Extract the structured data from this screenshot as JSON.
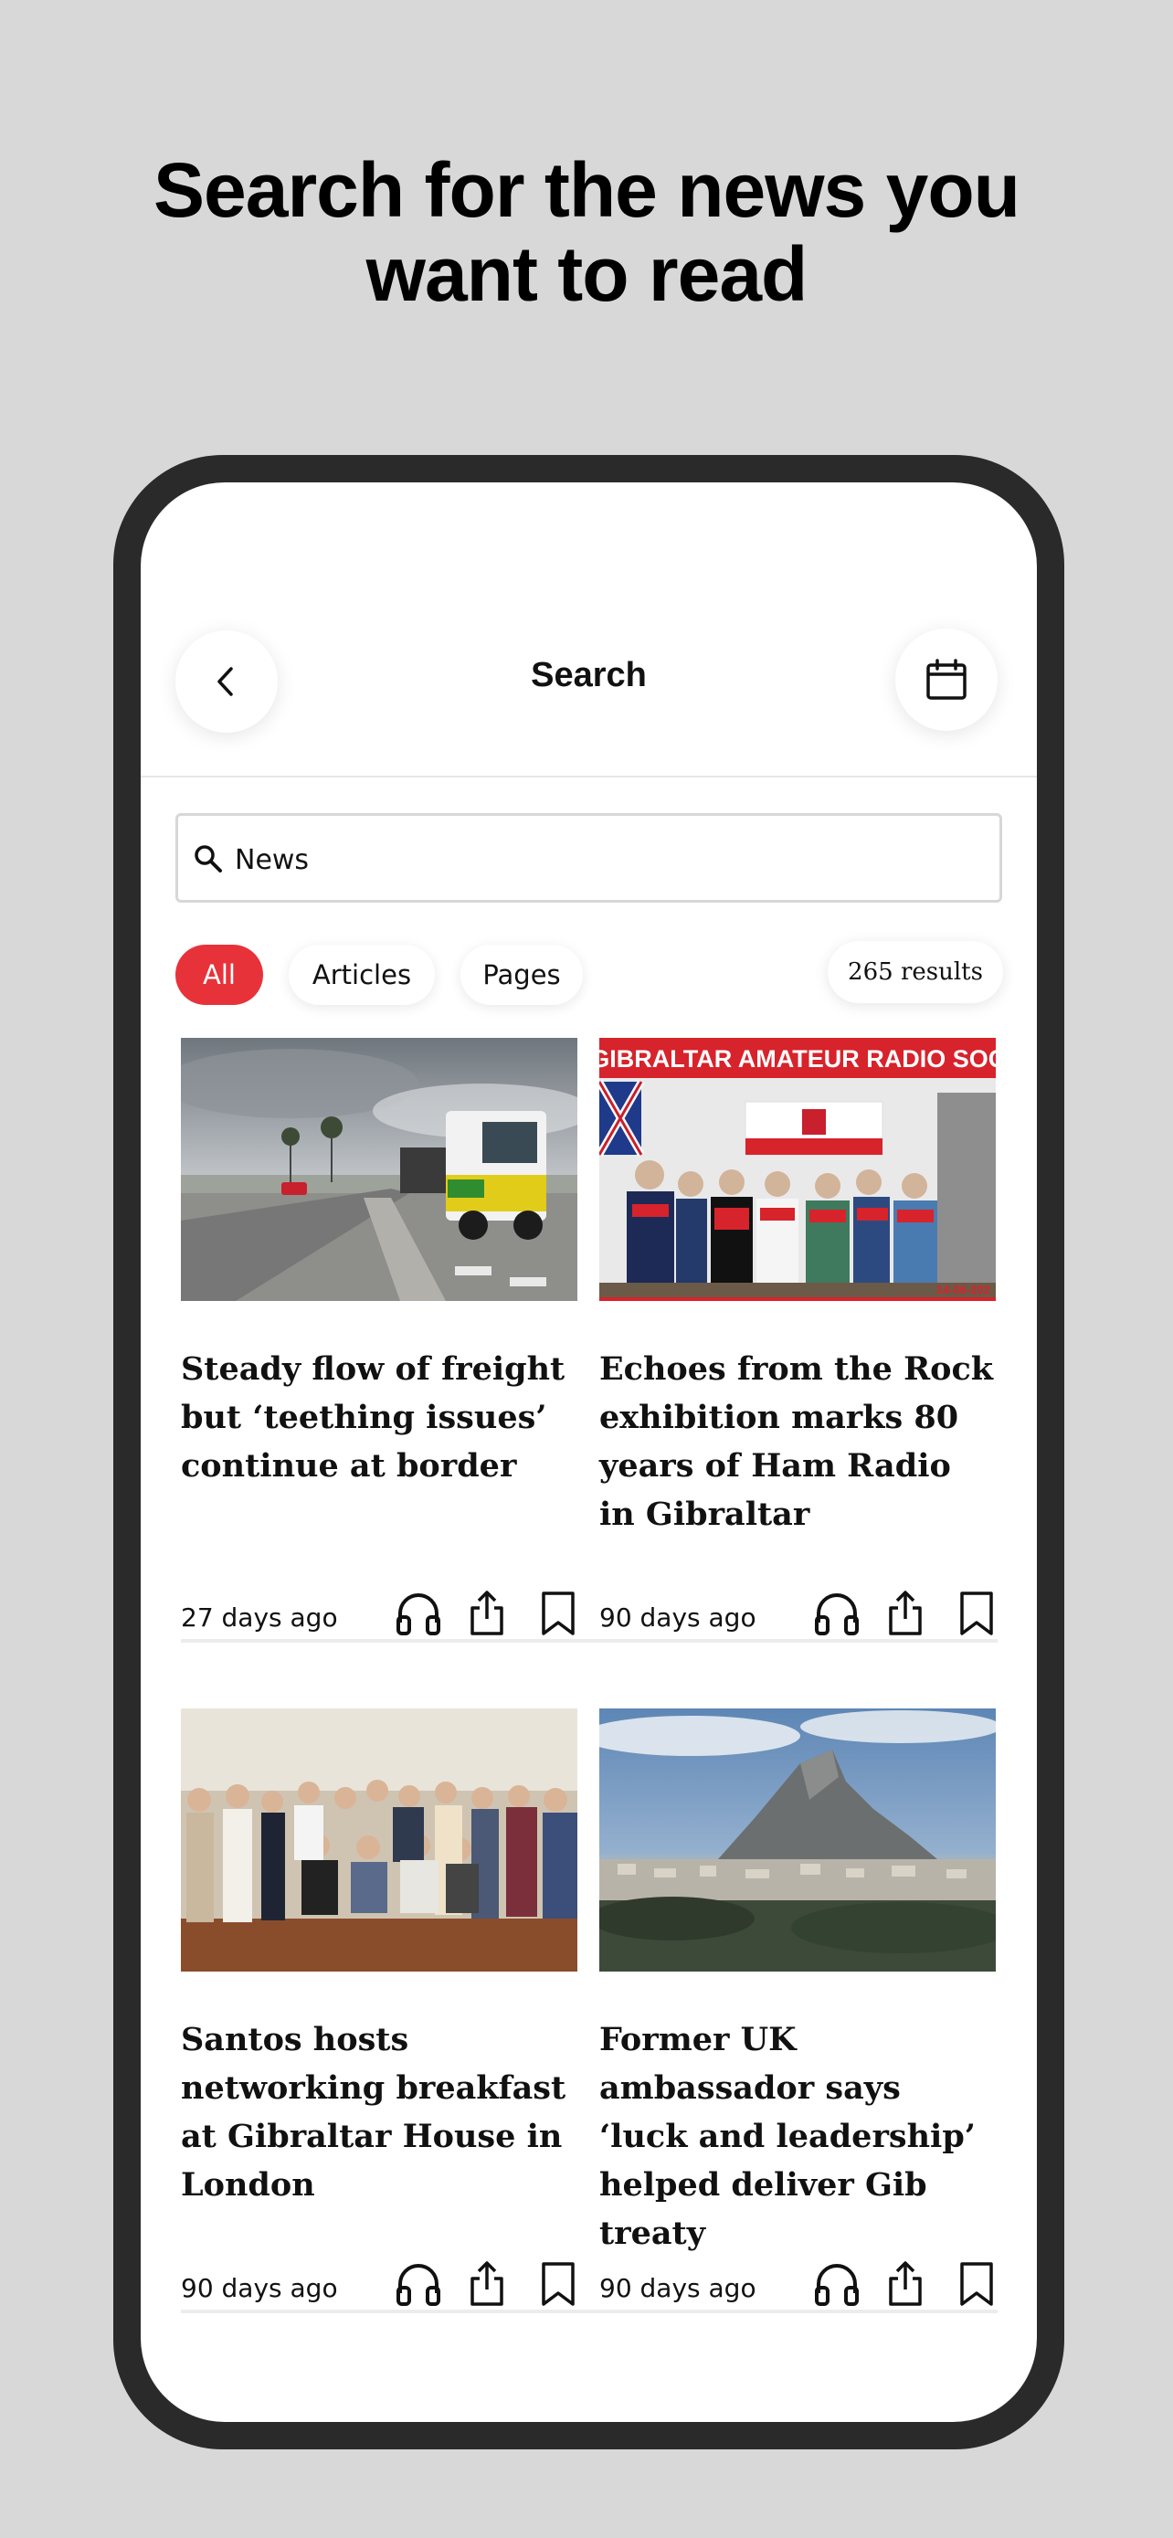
{
  "promo": {
    "headline_line1": "Search for the news you",
    "headline_line2": "want to read"
  },
  "header": {
    "title": "Search"
  },
  "search": {
    "value": "News"
  },
  "filters": [
    {
      "label": "All",
      "active": true
    },
    {
      "label": "Articles",
      "active": false
    },
    {
      "label": "Pages",
      "active": false
    }
  ],
  "results_count": "265 results",
  "colors": {
    "accent": "#e8323a",
    "frame": "#2a2a2a",
    "background": "#d8d8d8"
  },
  "articles": [
    {
      "title": "Steady flow of freight but ‘teething issues’ continue at border",
      "time": "27 days ago"
    },
    {
      "title": "Echoes from the Rock exhibition marks 80 years of Ham Radio in Gibraltar",
      "time": "90 days ago",
      "banner": "THE GIBRALTAR AMATEUR RADIO SOCIETY",
      "photo_date": "14-06-202"
    },
    {
      "title": "Santos hosts networking breakfast at Gibraltar House in London",
      "time": "90 days ago"
    },
    {
      "title": "Former UK ambassador says ‘luck and leadership’ helped deliver Gib treaty",
      "time": "90 days ago"
    }
  ],
  "icons": {
    "back": "chevron-left-icon",
    "calendar": "calendar-icon",
    "search": "search-icon",
    "listen": "headphones-icon",
    "share": "share-icon",
    "save": "bookmark-icon"
  }
}
